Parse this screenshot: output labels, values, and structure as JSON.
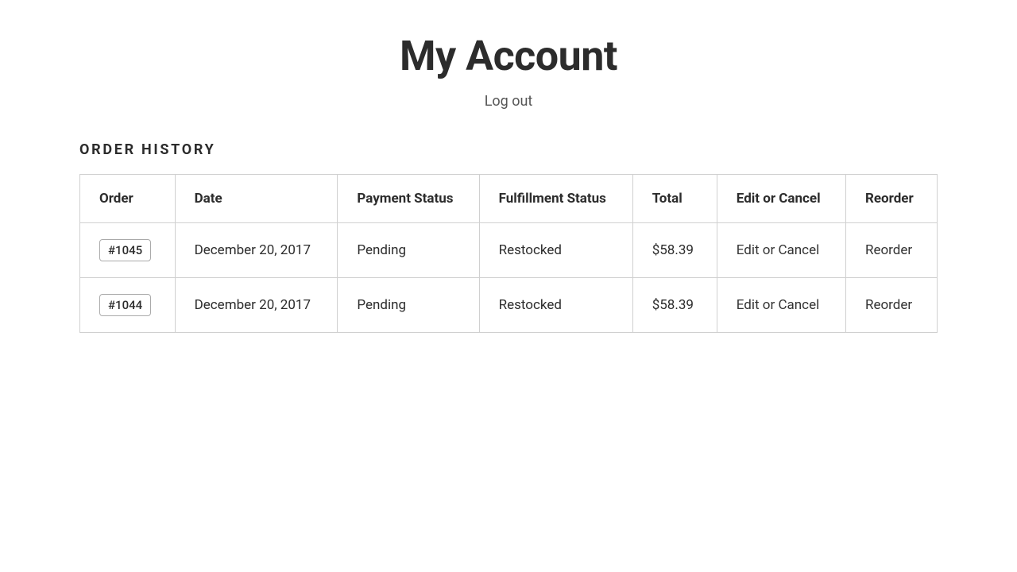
{
  "header": {
    "title": "My Account",
    "logout_label": "Log out"
  },
  "order_history": {
    "section_title": "ORDER HISTORY",
    "columns": [
      {
        "key": "order",
        "label": "Order"
      },
      {
        "key": "date",
        "label": "Date"
      },
      {
        "key": "payment_status",
        "label": "Payment Status"
      },
      {
        "key": "fulfillment_status",
        "label": "Fulfillment Status"
      },
      {
        "key": "total",
        "label": "Total"
      },
      {
        "key": "edit_or_cancel",
        "label": "Edit or Cancel"
      },
      {
        "key": "reorder",
        "label": "Reorder"
      }
    ],
    "rows": [
      {
        "order": "#1045",
        "date": "December 20, 2017",
        "payment_status": "Pending",
        "fulfillment_status": "Restocked",
        "total": "$58.39",
        "edit_or_cancel": "Edit or Cancel",
        "reorder": "Reorder"
      },
      {
        "order": "#1044",
        "date": "December 20, 2017",
        "payment_status": "Pending",
        "fulfillment_status": "Restocked",
        "total": "$58.39",
        "edit_or_cancel": "Edit or Cancel",
        "reorder": "Reorder"
      }
    ]
  }
}
